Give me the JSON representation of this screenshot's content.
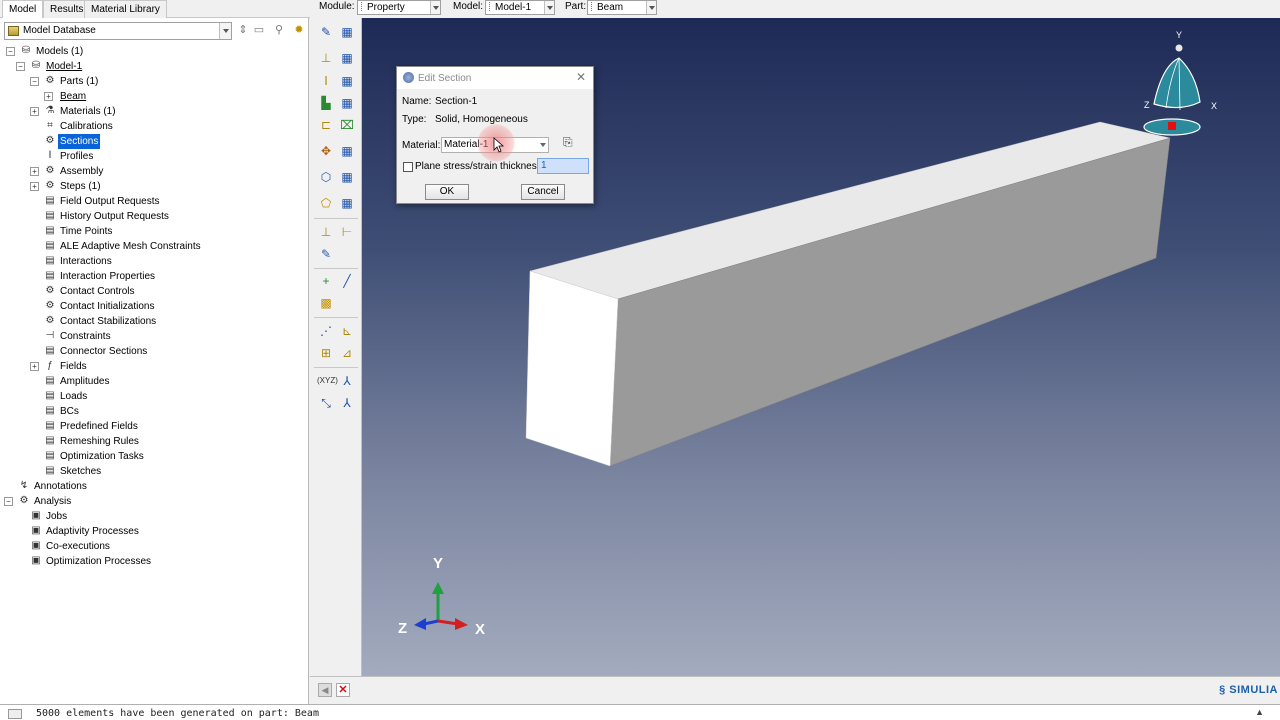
{
  "tabs": [
    "Model",
    "Results",
    "Material Library"
  ],
  "context_bar": {
    "module_label": "Module:",
    "module_value": "Property",
    "model_label": "Model:",
    "model_value": "Model-1",
    "part_label": "Part:",
    "part_value": "Beam"
  },
  "tree": {
    "database": "Model Database",
    "items": [
      {
        "label": "Models (1)",
        "icon": "models-icon"
      },
      {
        "label": "Model-1",
        "icon": "model-icon"
      },
      {
        "label": "Parts (1)",
        "icon": "parts-icon"
      },
      {
        "label": "Beam",
        "icon": ""
      },
      {
        "label": "Materials (1)",
        "icon": "materials-icon"
      },
      {
        "label": "Calibrations",
        "icon": "calibrations-icon"
      },
      {
        "label": "Sections",
        "icon": "sections-icon"
      },
      {
        "label": "Profiles",
        "icon": "profiles-icon"
      },
      {
        "label": "Assembly",
        "icon": "assembly-icon"
      },
      {
        "label": "Steps (1)",
        "icon": "steps-icon"
      },
      {
        "label": "Field Output Requests",
        "icon": "field-output-icon"
      },
      {
        "label": "History Output Requests",
        "icon": "history-output-icon"
      },
      {
        "label": "Time Points",
        "icon": "time-points-icon"
      },
      {
        "label": "ALE Adaptive Mesh Constraints",
        "icon": "ale-icon"
      },
      {
        "label": "Interactions",
        "icon": "interactions-icon"
      },
      {
        "label": "Interaction Properties",
        "icon": "interaction-properties-icon"
      },
      {
        "label": "Contact Controls",
        "icon": "contact-controls-icon"
      },
      {
        "label": "Contact Initializations",
        "icon": "contact-init-icon"
      },
      {
        "label": "Contact Stabilizations",
        "icon": "contact-stab-icon"
      },
      {
        "label": "Constraints",
        "icon": "constraints-icon"
      },
      {
        "label": "Connector Sections",
        "icon": "connector-sections-icon"
      },
      {
        "label": "Fields",
        "icon": "fields-icon"
      },
      {
        "label": "Amplitudes",
        "icon": "amplitudes-icon"
      },
      {
        "label": "Loads",
        "icon": "loads-icon"
      },
      {
        "label": "BCs",
        "icon": "bcs-icon"
      },
      {
        "label": "Predefined Fields",
        "icon": "predefined-fields-icon"
      },
      {
        "label": "Remeshing Rules",
        "icon": "remeshing-icon"
      },
      {
        "label": "Optimization Tasks",
        "icon": "optimization-tasks-icon"
      },
      {
        "label": "Sketches",
        "icon": "sketches-icon"
      },
      {
        "label": "Annotations",
        "icon": "annotations-icon"
      },
      {
        "label": "Analysis",
        "icon": "analysis-icon"
      },
      {
        "label": "Jobs",
        "icon": "jobs-icon"
      },
      {
        "label": "Adaptivity Processes",
        "icon": "adaptivity-icon"
      },
      {
        "label": "Co-executions",
        "icon": "co-executions-icon"
      },
      {
        "label": "Optimization Processes",
        "icon": "optimization-processes-icon"
      }
    ]
  },
  "dialog": {
    "title": "Edit Section",
    "name_label": "Name:",
    "name_value": "Section-1",
    "type_label": "Type:",
    "type_value": "Solid, Homogeneous",
    "material_label": "Material:",
    "material_value": "Material-1",
    "thickness_label": "Plane stress/strain thickness:",
    "thickness_value": "1",
    "ok_label": "OK",
    "cancel_label": "Cancel"
  },
  "triad": {
    "x": "X",
    "y": "Y",
    "z": "Z"
  },
  "view_cube": {
    "x": "X",
    "y": "Y",
    "z": "Z"
  },
  "message": "5000 elements have been generated on part: Beam",
  "brand": "SIMULIA",
  "colors": {
    "selection": "#0a64d8",
    "viewport_top": "#1d2a56",
    "viewport_bottom": "#a3abbe",
    "axis_x": "#d02020",
    "axis_y": "#20a040",
    "axis_z": "#1c3fd0"
  }
}
